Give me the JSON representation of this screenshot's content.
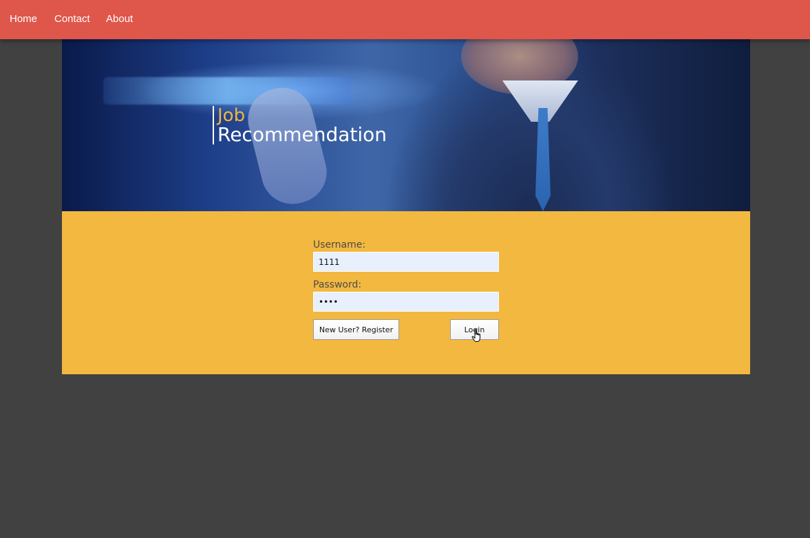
{
  "nav": {
    "items": [
      {
        "label": "Home"
      },
      {
        "label": "Contact"
      },
      {
        "label": "About"
      }
    ]
  },
  "hero": {
    "title_line1": "Job",
    "title_line2": "Recommendation"
  },
  "login": {
    "username_label": "Username:",
    "username_value": "1111",
    "password_label": "Password:",
    "password_value": "1111",
    "register_label": "New User? Register",
    "login_label": "Login"
  },
  "colors": {
    "nav_bg": "#df564b",
    "page_bg": "#414141",
    "panel_bg": "#f2b840",
    "title_accent": "#f2b640",
    "input_bg": "#e8effd"
  }
}
